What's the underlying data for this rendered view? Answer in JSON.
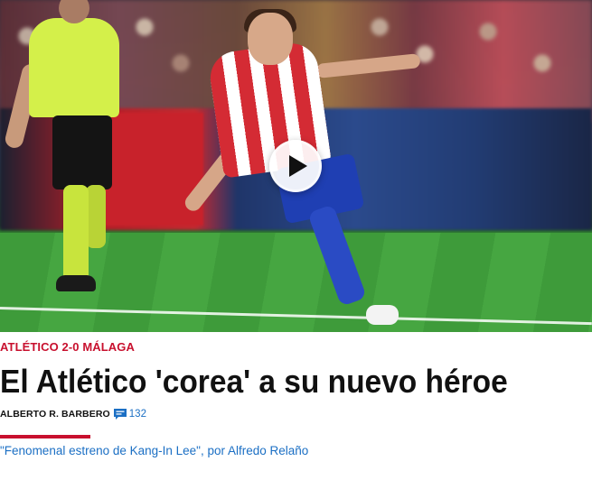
{
  "article": {
    "kicker": "ATLÉTICO 2-0 MÁLAGA",
    "headline": "El Atlético 'corea' a su nuevo héroe",
    "author": "ALBERTO R. BARBERO",
    "comment_count": "132",
    "related_link": "\"Fenomenal estreno de Kang-In Lee\", por Alfredo Relaño"
  },
  "media": {
    "play_icon": "play-icon",
    "comment_icon": "comment-icon"
  },
  "colors": {
    "kicker": "#c8102e",
    "link": "#1b6fc4",
    "divider": "#c8102e"
  }
}
